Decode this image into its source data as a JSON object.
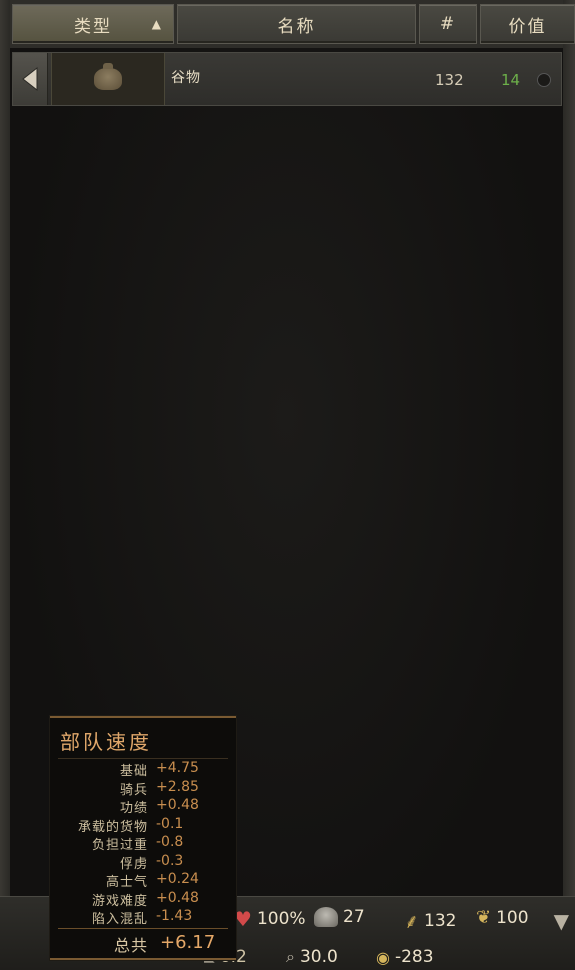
{
  "header": {
    "type_label": "类型",
    "name_label": "名称",
    "count_label": "#",
    "value_label": "价值",
    "sort_icon": "sort-up-arrow"
  },
  "items": [
    {
      "name": "谷物",
      "count": "132",
      "value": "14",
      "icon": "grain-sack",
      "value_color": "#6db04a"
    }
  ],
  "status": {
    "morale": "100%",
    "troops": "27",
    "food": "132",
    "wages": "100",
    "speed": "6.2",
    "view": "30.0",
    "gold_change": "-283"
  },
  "tooltip": {
    "title": "部队速度",
    "rows": [
      {
        "label": "基础",
        "value": "+4.75"
      },
      {
        "label": "骑兵",
        "value": "+2.85"
      },
      {
        "label": "功绩",
        "value": "+0.48"
      },
      {
        "label": "承载的货物",
        "value": "-0.1"
      },
      {
        "label": "负担过重",
        "value": "-0.8"
      },
      {
        "label": "俘虏",
        "value": "-0.3"
      },
      {
        "label": "高士气",
        "value": "+0.24"
      },
      {
        "label": "游戏难度",
        "value": "+0.48"
      },
      {
        "label": "陷入混乱",
        "value": "-1.43"
      }
    ],
    "total_label": "总共",
    "total_value": "+6.17"
  }
}
